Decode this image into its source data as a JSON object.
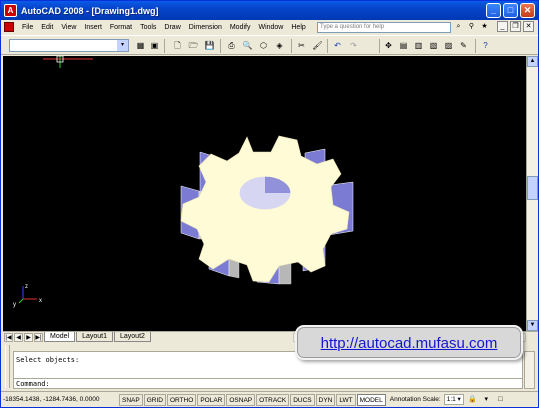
{
  "window": {
    "title": "AutoCAD 2008 - [Drawing1.dwg]",
    "app_icon_glyph": "A",
    "minimize_glyph": "_",
    "maximize_glyph": "□",
    "close_glyph": "✕"
  },
  "menubar": {
    "items": [
      "File",
      "Edit",
      "View",
      "Insert",
      "Format",
      "Tools",
      "Draw",
      "Dimension",
      "Modify",
      "Window",
      "Help"
    ],
    "help_search_placeholder": "Type a question for help",
    "mdi_minimize": "_",
    "mdi_restore": "❐",
    "mdi_close": "✕"
  },
  "toolbar": {
    "workspace_value": "",
    "combo_arrow": "▾"
  },
  "drawing": {
    "ucs_icon": "ucs-icon",
    "gear_fill": "#fffbd6",
    "gear_side": "#7b7bd4",
    "background": "#000000"
  },
  "layout_tabs": {
    "nav": [
      "|◀",
      "◀",
      "▶",
      "▶|"
    ],
    "tabs": [
      "Model",
      "Layout1",
      "Layout2"
    ]
  },
  "command": {
    "history_line": "Select objects:",
    "prompt": "Command:"
  },
  "banner": {
    "url_text": "http://autocad.mufasu.com"
  },
  "statusbar": {
    "coordinates": "-18354.1438, -1284.7436, 0.0000",
    "toggles": [
      "SNAP",
      "GRID",
      "ORTHO",
      "POLAR",
      "OSNAP",
      "OTRACK",
      "DUCS",
      "DYN",
      "LWT",
      "MODEL"
    ],
    "annotation_label": "Annotation Scale:",
    "annotation_value": "1:1 ▾"
  }
}
